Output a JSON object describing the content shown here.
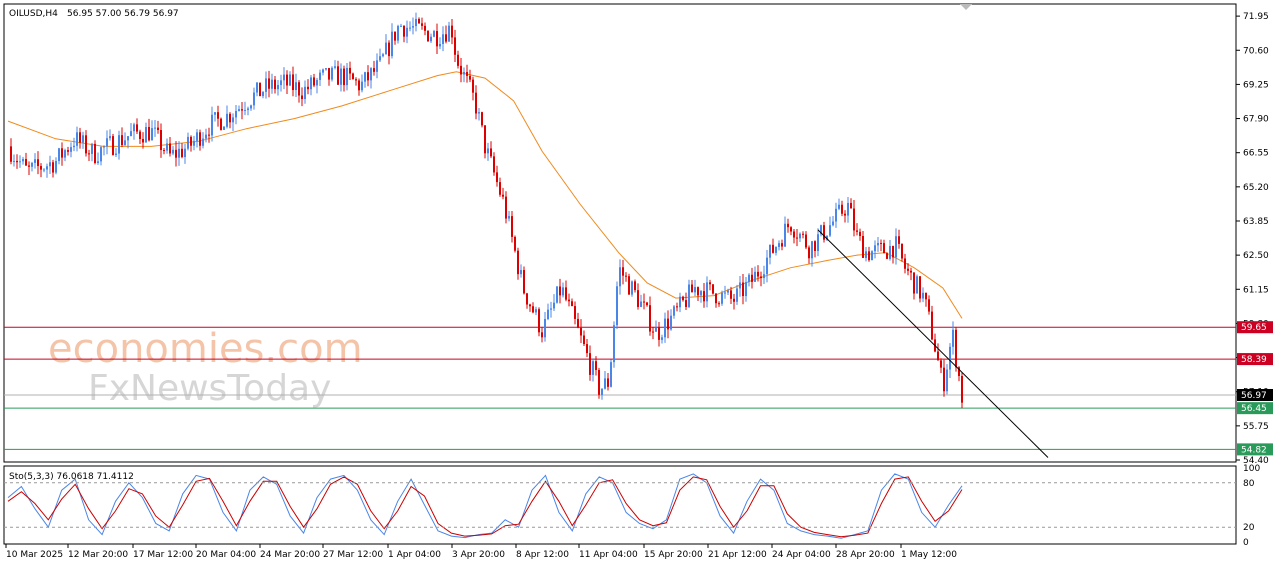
{
  "header": {
    "symbol": "OILUSD,H4",
    "ohlc": "56.95 57.00 56.79 56.97"
  },
  "watermark": {
    "line1": "economies.com",
    "line2": "FxNewsToday"
  },
  "stochastic": {
    "label": "Sto(5,3,3) 76.0618 71.4112",
    "levels": [
      100,
      80,
      20,
      0
    ],
    "main_color": "#4a86e8",
    "signal_color": "#cc0000"
  },
  "chart_data": {
    "type": "candlestick",
    "title": "OILUSD,H4",
    "ylim": [
      54.4,
      72.35
    ],
    "y_ticks": [
      "71.95",
      "70.60",
      "69.25",
      "67.90",
      "66.55",
      "65.20",
      "63.85",
      "62.50",
      "61.15",
      "59.80",
      "58.45",
      "57.10",
      "55.75",
      "54.40"
    ],
    "x_ticks": [
      "10 Mar 2025",
      "12 Mar 20:00",
      "17 Mar 12:00",
      "20 Mar 04:00",
      "24 Mar 20:00",
      "27 Mar 12:00",
      "1 Apr 04:00",
      "3 Apr 20:00",
      "8 Apr 12:00",
      "11 Apr 04:00",
      "15 Apr 20:00",
      "21 Apr 12:00",
      "24 Apr 04:00",
      "28 Apr 20:00",
      "1 May 12:00"
    ],
    "up_color": "#4a86e8",
    "down_color": "#dd0000",
    "ma_color": "#f08a1c",
    "horizontal_levels": [
      {
        "label": "59.65",
        "value": 59.65,
        "color": "#cc0022"
      },
      {
        "label": "58.39",
        "value": 58.39,
        "color": "#cc0022"
      },
      {
        "label": "56.97",
        "value": 56.97,
        "color": "#000000"
      },
      {
        "label": "56.45",
        "value": 56.45,
        "color": "#2a9a5a"
      },
      {
        "label": "54.82",
        "value": 54.82,
        "color": "#2a9a5a"
      }
    ],
    "trendline": {
      "start": [
        0,
        63.5
      ],
      "end": [
        1,
        54.5
      ],
      "color": "#000000"
    },
    "price_path": [
      [
        0,
        66.8
      ],
      [
        0.02,
        65.8
      ],
      [
        0.05,
        66.2
      ],
      [
        0.07,
        67.1
      ],
      [
        0.09,
        66.5
      ],
      [
        0.11,
        66.9
      ],
      [
        0.13,
        67.3
      ],
      [
        0.15,
        67.4
      ],
      [
        0.17,
        66.4
      ],
      [
        0.19,
        66.8
      ],
      [
        0.21,
        67.6
      ],
      [
        0.23,
        68.0
      ],
      [
        0.25,
        68.6
      ],
      [
        0.27,
        69.1
      ],
      [
        0.29,
        69.3
      ],
      [
        0.31,
        69.0
      ],
      [
        0.33,
        69.5
      ],
      [
        0.35,
        69.6
      ],
      [
        0.37,
        69.2
      ],
      [
        0.39,
        70.0
      ],
      [
        0.41,
        71.6
      ],
      [
        0.43,
        71.4
      ],
      [
        0.45,
        71.2
      ],
      [
        0.465,
        71.5
      ],
      [
        0.47,
        70.3
      ],
      [
        0.49,
        68.5
      ],
      [
        0.5,
        66.8
      ],
      [
        0.52,
        64.5
      ],
      [
        0.54,
        61.2
      ],
      [
        0.56,
        59.5
      ],
      [
        0.58,
        61.2
      ],
      [
        0.6,
        59.2
      ],
      [
        0.62,
        57.2
      ],
      [
        0.63,
        57.5
      ],
      [
        0.64,
        62.0
      ],
      [
        0.66,
        60.8
      ],
      [
        0.68,
        59.4
      ],
      [
        0.7,
        60.2
      ],
      [
        0.72,
        61.2
      ],
      [
        0.74,
        61.0
      ],
      [
        0.76,
        60.7
      ],
      [
        0.78,
        61.5
      ],
      [
        0.8,
        62.6
      ],
      [
        0.82,
        63.8
      ],
      [
        0.84,
        62.8
      ],
      [
        0.86,
        63.6
      ],
      [
        0.88,
        64.5
      ],
      [
        0.89,
        63.2
      ],
      [
        0.9,
        62.6
      ],
      [
        0.92,
        62.7
      ],
      [
        0.93,
        62.9
      ],
      [
        0.94,
        62.0
      ],
      [
        0.96,
        60.8
      ],
      [
        0.97,
        59.2
      ],
      [
        0.98,
        57.3
      ],
      [
        0.99,
        59.4
      ],
      [
        1.0,
        56.9
      ]
    ],
    "ma_path": [
      [
        0,
        67.8
      ],
      [
        0.05,
        67.1
      ],
      [
        0.1,
        66.8
      ],
      [
        0.15,
        66.8
      ],
      [
        0.2,
        67.0
      ],
      [
        0.25,
        67.5
      ],
      [
        0.3,
        67.9
      ],
      [
        0.35,
        68.4
      ],
      [
        0.4,
        69.0
      ],
      [
        0.45,
        69.6
      ],
      [
        0.47,
        69.75
      ],
      [
        0.5,
        69.5
      ],
      [
        0.53,
        68.6
      ],
      [
        0.56,
        66.6
      ],
      [
        0.6,
        64.5
      ],
      [
        0.64,
        62.6
      ],
      [
        0.67,
        61.4
      ],
      [
        0.7,
        60.8
      ],
      [
        0.74,
        60.9
      ],
      [
        0.78,
        61.5
      ],
      [
        0.82,
        62.0
      ],
      [
        0.86,
        62.3
      ],
      [
        0.89,
        62.5
      ],
      [
        0.92,
        62.6
      ],
      [
        0.95,
        62.0
      ],
      [
        0.98,
        61.2
      ],
      [
        1.0,
        60.0
      ]
    ],
    "stoch_main": [
      60,
      75,
      45,
      20,
      70,
      85,
      30,
      10,
      55,
      80,
      60,
      25,
      15,
      65,
      90,
      85,
      40,
      15,
      70,
      88,
      78,
      35,
      12,
      60,
      85,
      90,
      70,
      30,
      10,
      55,
      85,
      50,
      15,
      8,
      6,
      10,
      12,
      30,
      20,
      70,
      90,
      40,
      15,
      65,
      88,
      80,
      40,
      25,
      18,
      30,
      85,
      92,
      80,
      35,
      12,
      55,
      85,
      70,
      25,
      15,
      10,
      8,
      5,
      10,
      15,
      70,
      92,
      85,
      40,
      20,
      50,
      76
    ],
    "stoch_signal": [
      55,
      68,
      52,
      30,
      58,
      78,
      45,
      18,
      42,
      72,
      65,
      35,
      20,
      50,
      82,
      86,
      55,
      22,
      55,
      82,
      82,
      48,
      20,
      45,
      78,
      88,
      78,
      42,
      18,
      42,
      75,
      62,
      25,
      12,
      8,
      9,
      11,
      22,
      24,
      55,
      82,
      55,
      22,
      50,
      80,
      84,
      52,
      30,
      22,
      26,
      70,
      88,
      84,
      48,
      20,
      42,
      76,
      76,
      38,
      20,
      13,
      10,
      7,
      9,
      12,
      52,
      85,
      88,
      55,
      28,
      42,
      71
    ]
  }
}
